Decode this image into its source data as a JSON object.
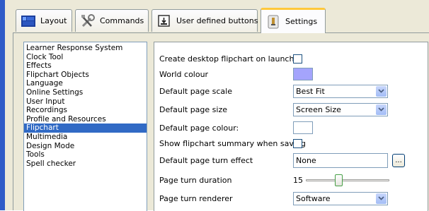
{
  "tabs": [
    {
      "label": "Layout",
      "icon": "layout-icon"
    },
    {
      "label": "Commands",
      "icon": "tools-icon"
    },
    {
      "label": "User defined buttons",
      "icon": "user-button-icon"
    },
    {
      "label": "Settings",
      "icon": "settings-icon",
      "active": true
    }
  ],
  "categories": [
    "Learner Response System",
    "Clock Tool",
    "Effects",
    "Flipchart Objects",
    "Language",
    "Online Settings",
    "User Input",
    "Recordings",
    "Profile and Resources",
    "Flipchart",
    "Multimedia",
    "Design Mode",
    "Tools",
    "Spell checker"
  ],
  "selected_category": "Flipchart",
  "settings": {
    "create_desktop": {
      "label": "Create desktop flipchart on launch",
      "checked": false
    },
    "world_colour": {
      "label": "World colour",
      "color": "#a4a4fc"
    },
    "page_scale": {
      "label": "Default page scale",
      "value": "Best Fit"
    },
    "page_size": {
      "label": "Default page size",
      "value": "Screen Size"
    },
    "page_colour": {
      "label": "Default page colour:",
      "color": "#ffffff"
    },
    "show_summary": {
      "label": "Show flipchart summary when saving",
      "checked": false
    },
    "turn_effect": {
      "label": "Default page turn effect",
      "value": "None",
      "browse": "..."
    },
    "turn_duration": {
      "label": "Page turn duration",
      "value": "15",
      "fraction": 0.38
    },
    "turn_renderer": {
      "label": "Page turn renderer",
      "value": "Software"
    }
  },
  "colors": {
    "accent_blue": "#316ac5",
    "tab_highlight": "#ffc83c"
  }
}
